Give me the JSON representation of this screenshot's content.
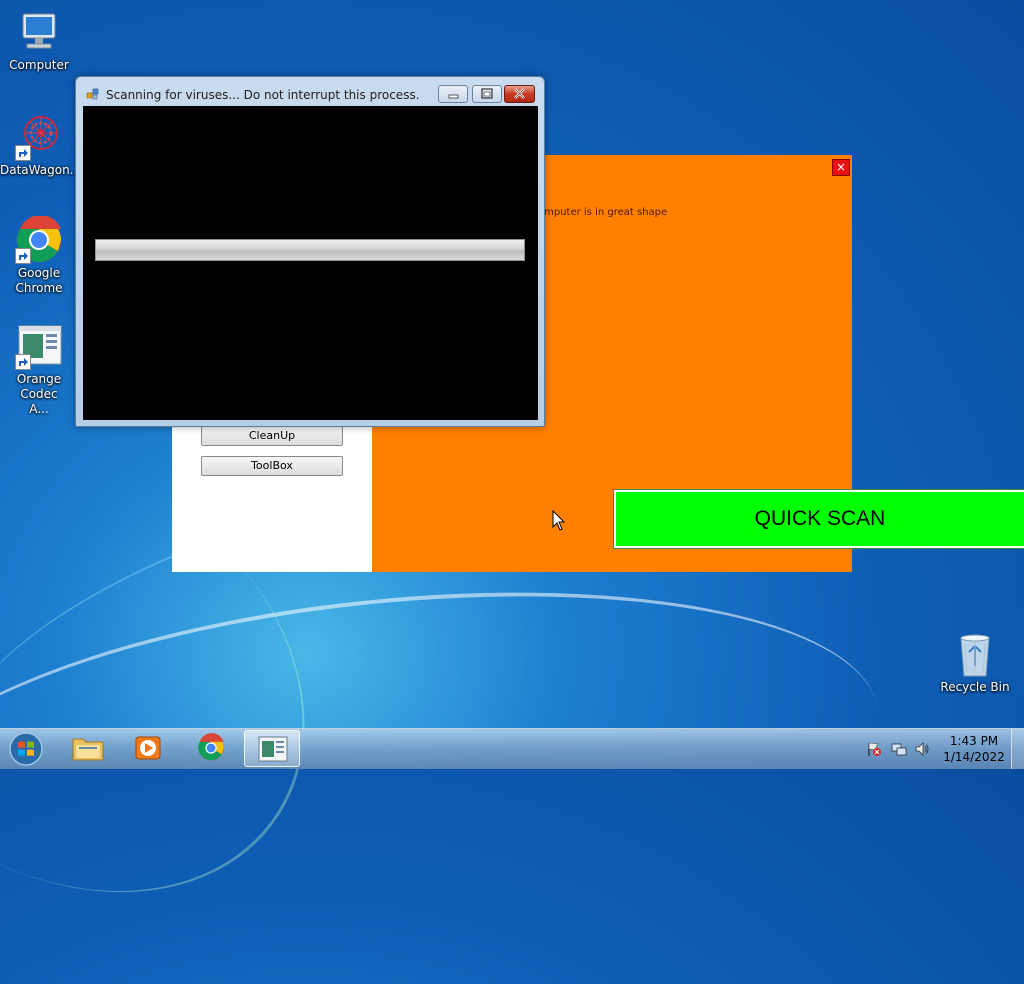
{
  "desktop": {
    "icons": [
      {
        "label": "Computer"
      },
      {
        "label": "DataWagon..."
      },
      {
        "label": "Google Chrome"
      },
      {
        "label": "Orange Codec A..."
      },
      {
        "label": "Recycle Bin"
      }
    ]
  },
  "app": {
    "status_text": "omputer is in great shape",
    "close_label": "×",
    "buttons": [
      "CleanUp",
      "ToolBox"
    ],
    "quick_scan_label": "QUICK SCAN"
  },
  "scan_window": {
    "title": "Scanning for viruses... Do not interrupt this process.",
    "progress_fraction": 0.0
  },
  "taskbar": {
    "items": [
      "start-orb",
      "windows-explorer",
      "windows-media-player",
      "google-chrome",
      "orange-codec-app"
    ],
    "clock": {
      "time": "1:43 PM",
      "date": "1/14/2022"
    },
    "tray_icons": [
      "action-center-flag-icon",
      "network-icon",
      "volume-icon"
    ]
  }
}
